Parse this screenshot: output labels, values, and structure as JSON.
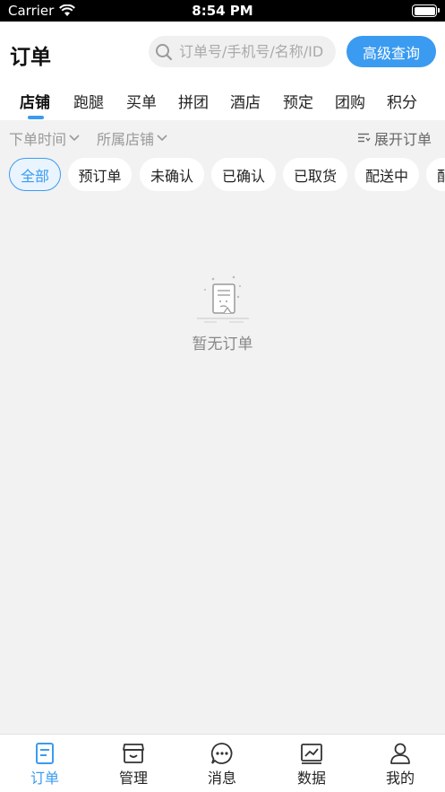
{
  "status_bar": {
    "carrier": "Carrier",
    "time": "8:54 PM"
  },
  "header": {
    "title": "订单",
    "search_placeholder": "订单号/手机号/名称/ID",
    "advanced_search_label": "高级查询"
  },
  "tabs": [
    "店铺",
    "跑腿",
    "买单",
    "拼团",
    "酒店",
    "预定",
    "团购",
    "积分"
  ],
  "active_tab": "店铺",
  "filters": {
    "order_time_label": "下单时间",
    "store_label": "所属店铺",
    "expand_label": "展开订单"
  },
  "status_chips": [
    "全部",
    "预订单",
    "未确认",
    "已确认",
    "已取货",
    "配送中",
    "配"
  ],
  "empty_state": {
    "text": "暂无订单"
  },
  "bottom_nav": {
    "items": [
      "订单",
      "管理",
      "消息",
      "数据",
      "我的"
    ],
    "active": "订单"
  },
  "colors": {
    "accent": "#3a9bf0",
    "background": "#f2f2f2"
  }
}
